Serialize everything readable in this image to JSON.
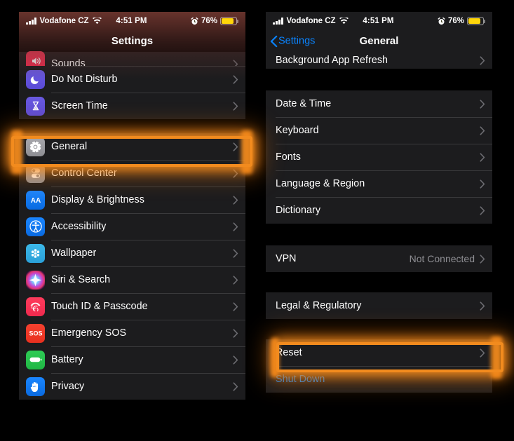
{
  "meta": {
    "accent_highlight": "#f28b1e",
    "list_bg": "#1c1c1e",
    "page_bg": "#000000",
    "link_blue": "#0a84ff",
    "secondary_text": "#8e8e93"
  },
  "status_bar": {
    "carrier": "Vodafone CZ",
    "time": "4:51 PM",
    "battery_percent": "76%",
    "icons": [
      "signal-bars-icon",
      "wifi-icon",
      "alarm-clock-icon",
      "battery-icon"
    ]
  },
  "left_screen": {
    "title": "Settings",
    "groups": [
      {
        "rows": [
          {
            "label": "Sounds",
            "icon": "sounds-icon",
            "clipped": true,
            "chevron": true
          },
          {
            "label": "Do Not Disturb",
            "icon": "do-not-disturb-icon",
            "chevron": true
          },
          {
            "label": "Screen Time",
            "icon": "screen-time-icon",
            "chevron": true
          }
        ]
      },
      {
        "rows": [
          {
            "label": "General",
            "icon": "general-gear-icon",
            "chevron": true,
            "highlighted": true
          },
          {
            "label": "Control Center",
            "icon": "control-center-icon",
            "chevron": true
          },
          {
            "label": "Display & Brightness",
            "icon": "display-brightness-icon",
            "chevron": true
          },
          {
            "label": "Accessibility",
            "icon": "accessibility-icon",
            "chevron": true
          },
          {
            "label": "Wallpaper",
            "icon": "wallpaper-icon",
            "chevron": true
          },
          {
            "label": "Siri & Search",
            "icon": "siri-search-icon",
            "chevron": true
          },
          {
            "label": "Touch ID & Passcode",
            "icon": "touch-id-icon",
            "chevron": true
          },
          {
            "label": "Emergency SOS",
            "icon": "emergency-sos-icon",
            "chevron": true
          },
          {
            "label": "Battery",
            "icon": "battery-settings-icon",
            "chevron": true
          },
          {
            "label": "Privacy",
            "icon": "privacy-hand-icon",
            "chevron": true
          }
        ]
      }
    ]
  },
  "right_screen": {
    "back_label": "Settings",
    "title": "General",
    "groups": [
      {
        "rows": [
          {
            "label": "Background App Refresh",
            "chevron": true,
            "clipped": true
          }
        ]
      },
      {
        "rows": [
          {
            "label": "Date & Time",
            "chevron": true
          },
          {
            "label": "Keyboard",
            "chevron": true
          },
          {
            "label": "Fonts",
            "chevron": true
          },
          {
            "label": "Language & Region",
            "chevron": true
          },
          {
            "label": "Dictionary",
            "chevron": true
          }
        ]
      },
      {
        "rows": [
          {
            "label": "VPN",
            "value": "Not Connected",
            "chevron": true
          }
        ]
      },
      {
        "rows": [
          {
            "label": "Legal & Regulatory",
            "chevron": true
          }
        ]
      },
      {
        "rows": [
          {
            "label": "Reset",
            "chevron": true,
            "highlighted": true
          },
          {
            "label": "Shut Down",
            "chevron": false,
            "blue": true
          }
        ]
      }
    ]
  }
}
